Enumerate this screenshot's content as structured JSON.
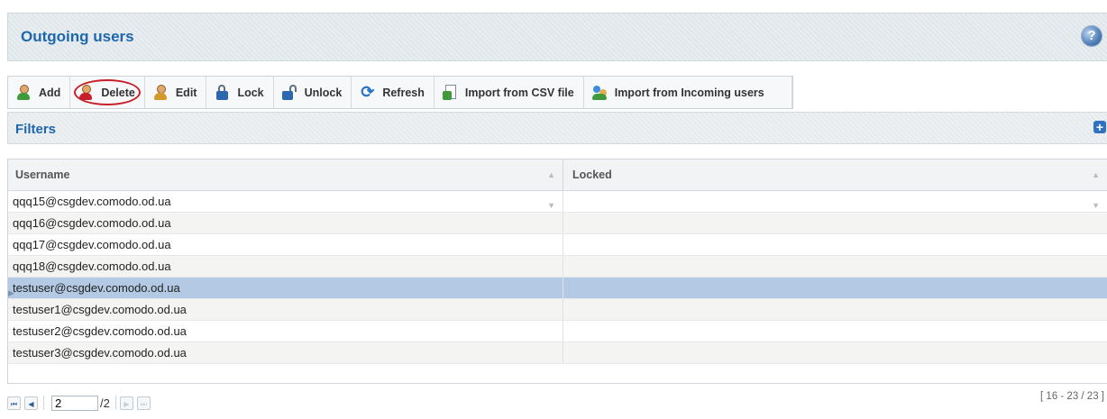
{
  "header": {
    "title": "Outgoing users",
    "help_icon": "?"
  },
  "toolbar": {
    "buttons": [
      {
        "label": "Add"
      },
      {
        "label": "Delete"
      },
      {
        "label": "Edit"
      },
      {
        "label": "Lock"
      },
      {
        "label": "Unlock"
      },
      {
        "label": "Refresh"
      },
      {
        "label": "Import from CSV file"
      },
      {
        "label": "Import from Incoming users"
      }
    ]
  },
  "filters": {
    "title": "Filters",
    "expand_icon": "+"
  },
  "grid": {
    "columns": [
      "Username",
      "Locked"
    ],
    "rows": [
      {
        "username": "qqq15@csgdev.comodo.od.ua",
        "locked": ""
      },
      {
        "username": "qqq16@csgdev.comodo.od.ua",
        "locked": ""
      },
      {
        "username": "qqq17@csgdev.comodo.od.ua",
        "locked": ""
      },
      {
        "username": "qqq18@csgdev.comodo.od.ua",
        "locked": ""
      },
      {
        "username": "testuser@csgdev.comodo.od.ua",
        "locked": ""
      },
      {
        "username": "testuser1@csgdev.comodo.od.ua",
        "locked": ""
      },
      {
        "username": "testuser2@csgdev.comodo.od.ua",
        "locked": ""
      },
      {
        "username": "testuser3@csgdev.comodo.od.ua",
        "locked": ""
      }
    ],
    "selected_index": 4
  },
  "pager": {
    "first": "⏮",
    "prev": "◀",
    "next": "▶",
    "last": "⏭",
    "current_page": "2",
    "total_pages": "/2",
    "range": "[ 16 - 23 / 23 ]"
  },
  "colors": {
    "title_blue": "#1e66ad",
    "selected_row": "#b4cae4",
    "highlight_ring": "#c8202a"
  }
}
